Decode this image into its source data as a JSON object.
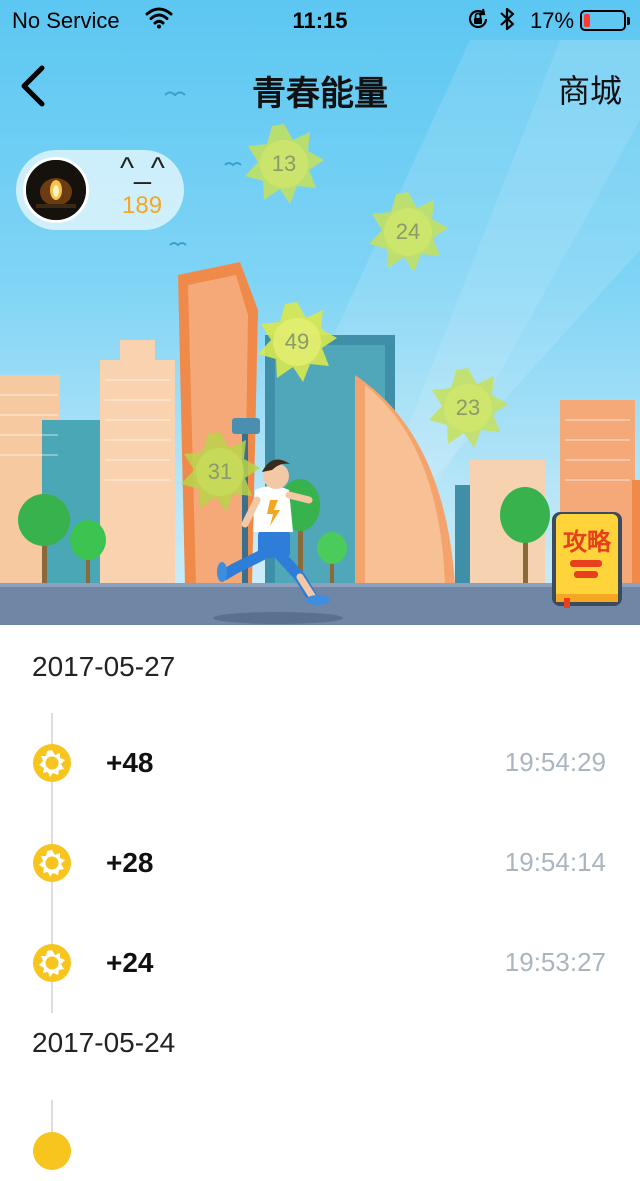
{
  "status_bar": {
    "carrier": "No Service",
    "time": "11:15",
    "battery_percent": "17%",
    "battery_level": 0.17
  },
  "nav": {
    "title": "青春能量",
    "shop_label": "商城",
    "back_icon": "chevron-left-icon"
  },
  "profile": {
    "face": "^_^",
    "score": "189"
  },
  "energy_bubbles": [
    {
      "value": "13"
    },
    {
      "value": "24"
    },
    {
      "value": "49"
    },
    {
      "value": "23"
    },
    {
      "value": "31"
    }
  ],
  "guide": {
    "label": "攻略"
  },
  "history": [
    {
      "date": "2017-05-27",
      "entries": [
        {
          "amount": "+48",
          "time": "19:54:29"
        },
        {
          "amount": "+28",
          "time": "19:54:14"
        },
        {
          "amount": "+24",
          "time": "19:53:27"
        }
      ]
    },
    {
      "date": "2017-05-24",
      "entries": []
    }
  ],
  "colors": {
    "sky": "#5cc7f2",
    "accent_orange": "#f5a623",
    "coin_yellow": "#f7c51e",
    "time_gray": "#aab5bf"
  }
}
